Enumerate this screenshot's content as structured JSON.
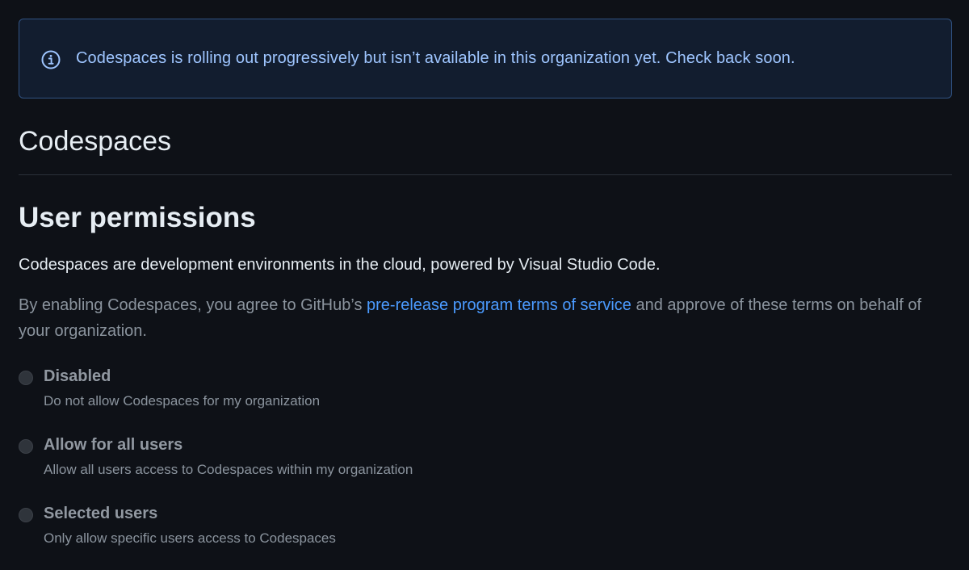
{
  "flash": {
    "icon": "info-icon",
    "message": "Codespaces is rolling out progressively but isn’t available in this organization yet. Check back soon."
  },
  "page": {
    "title": "Codespaces"
  },
  "permissions": {
    "heading": "User permissions",
    "description": "Codespaces are development environments in the cloud, powered by Visual Studio Code.",
    "terms_before": "By enabling Codespaces, you agree to GitHub’s ",
    "terms_link": "pre-release program terms of service",
    "terms_after": " and approve of these terms on behalf of your organization.",
    "options": [
      {
        "label": "Disabled",
        "note": "Do not allow Codespaces for my organization",
        "selected": false
      },
      {
        "label": "Allow for all users",
        "note": "Allow all users access to Codespaces within my organization",
        "selected": false
      },
      {
        "label": "Selected users",
        "note": "Only allow specific users access to Codespaces",
        "selected": false
      }
    ]
  },
  "colors": {
    "background": "#0e1117",
    "flash_bg": "#121d2f",
    "flash_border": "#315383",
    "flash_text": "#9ec5ff",
    "link": "#4b9bff",
    "muted": "#8b949e"
  }
}
